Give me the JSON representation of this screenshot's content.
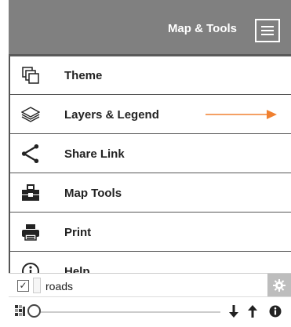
{
  "header": {
    "title": "Map & Tools",
    "menu_icon": "hamburger-icon"
  },
  "menu": {
    "items": [
      {
        "label": "Theme",
        "icon": "theme-icon"
      },
      {
        "label": "Layers & Legend",
        "icon": "layers-icon"
      },
      {
        "label": "Share Link",
        "icon": "share-icon"
      },
      {
        "label": "Map Tools",
        "icon": "toolbox-icon"
      },
      {
        "label": "Print",
        "icon": "printer-icon"
      },
      {
        "label": "Help",
        "icon": "help-icon"
      }
    ]
  },
  "annotation": {
    "arrow_color": "#f08030"
  },
  "layer": {
    "name": "roads",
    "checked": true,
    "opacity_value": 0
  },
  "colors": {
    "header_bg": "#808080",
    "accent_arrow": "#f08030",
    "text": "#222222"
  }
}
